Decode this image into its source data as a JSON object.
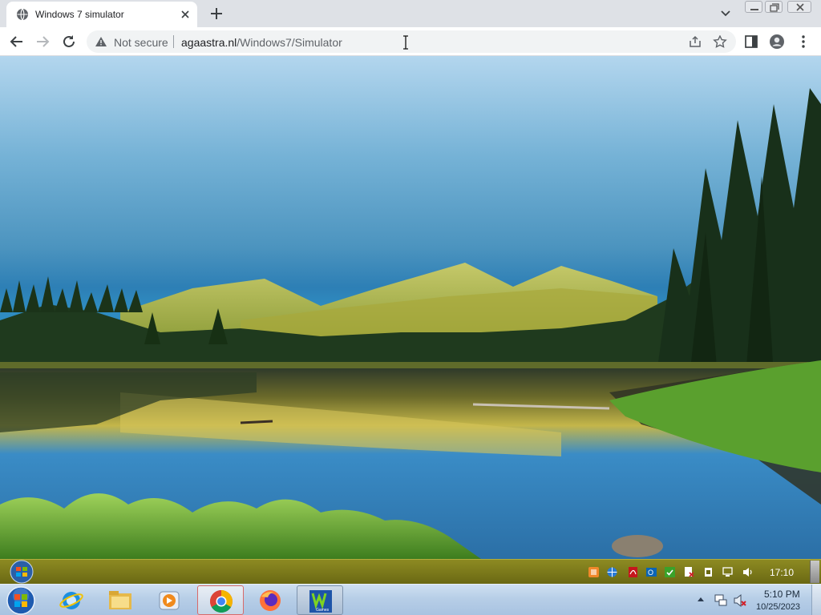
{
  "browser": {
    "tab": {
      "title": "Windows 7 simulator",
      "favicon": "globe-icon"
    },
    "new_tab_icon": "plus-icon",
    "tab_search_icon": "chevron-down-icon",
    "window_controls": [
      "minimize-icon",
      "restore-icon",
      "close-icon"
    ],
    "nav": [
      "back-arrow-icon",
      "forward-arrow-icon",
      "reload-icon"
    ],
    "omnibox": {
      "security_label": "Not secure",
      "security_icon": "warning-triangle-icon",
      "url_host": "agaastra.nl",
      "url_path": "/Windows7/Simulator"
    },
    "right_icons": [
      "share-icon",
      "bookmark-star-icon",
      "side-panel-icon",
      "profile-icon",
      "menu-dots-icon"
    ]
  },
  "desktop": {
    "wallpaper": "mountain lake landscape"
  },
  "sim_upper_bar": {
    "tray_icons": [
      "orange-app-icon",
      "network-globe-icon",
      "pdf-icon",
      "outlook-icon",
      "shield-check-icon",
      "blocked-document-icon",
      "usb-device-icon",
      "network-icon",
      "volume-icon"
    ],
    "clock": "17:10",
    "accent": "#8d8a22"
  },
  "sim_taskbar": {
    "pinned": [
      {
        "name": "internet-explorer",
        "icon": "internet-explorer-icon"
      },
      {
        "name": "windows-explorer",
        "icon": "folder-icon"
      },
      {
        "name": "media-player",
        "icon": "media-player-icon"
      },
      {
        "name": "google-chrome",
        "icon": "chrome-icon",
        "state": "active"
      },
      {
        "name": "firefox",
        "icon": "firefox-icon"
      },
      {
        "name": "games",
        "icon": "games-icon",
        "label": "Games",
        "state": "pressed"
      }
    ],
    "clock_time": "5:10 PM",
    "clock_date": "10/25/2023",
    "tray_icons": [
      "show-hidden-icons-arrow",
      "network-icon",
      "volume-muted-icon"
    ]
  }
}
